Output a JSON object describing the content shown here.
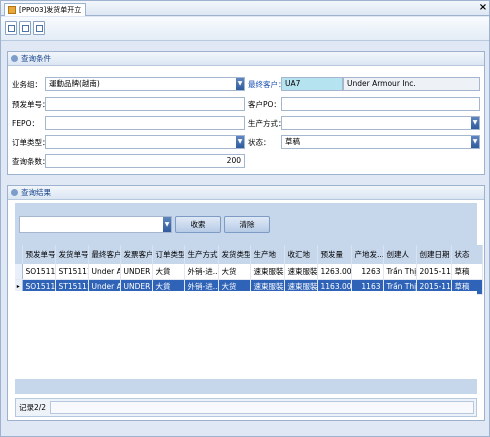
{
  "tab": {
    "title": "[PP003]发货单开立",
    "close": "×"
  },
  "toolbar": {
    "buttons": [
      "toolbar-button-1",
      "toolbar-button-2",
      "toolbar-button-3"
    ]
  },
  "query": {
    "header": "查询条件",
    "business_group_label": "业务组：",
    "business_group_value": "運動品牌(越南)",
    "final_customer_label": "最终客户：",
    "final_customer_code": "UA7",
    "final_customer_name": "Under Armour Inc.",
    "presend_no_label": "预发单号：",
    "presend_no_value": "",
    "customer_po_label": "客户PO：",
    "customer_po_value": "",
    "fepo_label": "FEPO：",
    "fepo_value": "",
    "production_mode_label": "生产方式：",
    "production_mode_value": "",
    "order_type_label": "订单类型：",
    "order_type_value": "",
    "status_label": "状态：",
    "status_value": "草稿",
    "query_count_label": "查询条数：",
    "query_count_value": "200"
  },
  "results": {
    "header": "查询结果",
    "search_value": "",
    "collapse_label": "收索",
    "clear_label": "清除",
    "columns": [
      "预发单号",
      "发货单号",
      "最终客户",
      "发票客户",
      "订单类型",
      "生产方式",
      "发货类型",
      "生产地",
      "收汇地",
      "预发量",
      "产地发...",
      "创建人",
      "创建日期",
      "状态"
    ],
    "rows": [
      [
        "SO15111...",
        "ST15111...",
        "Under Ar...",
        "UNDER A...",
        "大貨",
        "外销-进...",
        "大货",
        "速東服裝...",
        "速東服裝...",
        "1263.000...",
        "1263",
        "Trần Thị ...",
        "2015-11...",
        "草稿"
      ],
      [
        "SO15111...",
        "ST15111...",
        "Under Ar...",
        "UNDER A...",
        "大貨",
        "外销-进...",
        "大货",
        "速東服裝...",
        "速東服裝...",
        "1163.000...",
        "1163",
        "Trần Thị ...",
        "2015-11...",
        "草稿"
      ]
    ],
    "selected_row": 1,
    "record_label": "记录2/2"
  },
  "colors": {
    "accent": "#2f63b7",
    "highlight": "#b6e3f0",
    "band": "#c6d6eb"
  }
}
